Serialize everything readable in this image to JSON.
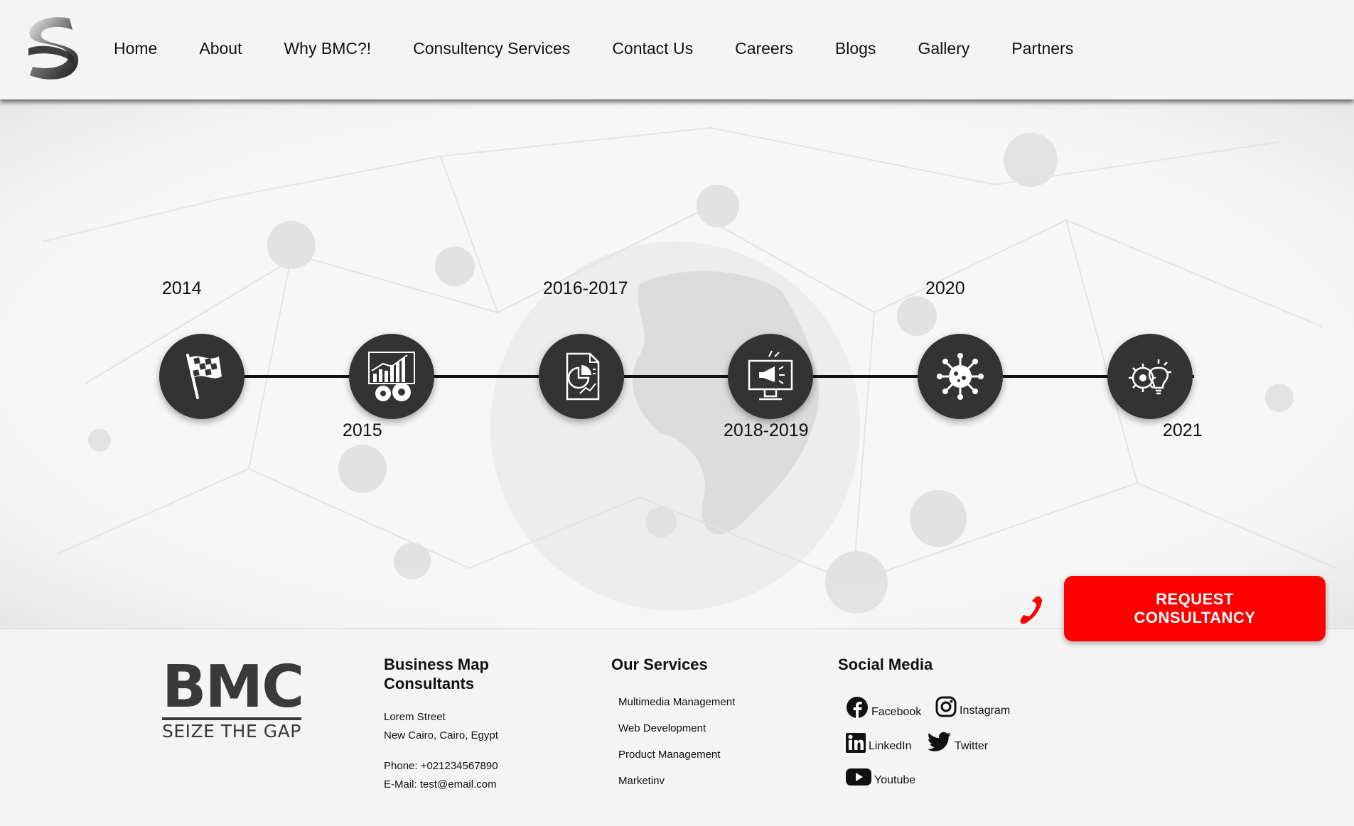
{
  "header": {
    "logo": "bmc-s-logo-icon",
    "nav": [
      "Home",
      "About",
      "Why BMC?!",
      "Consultency Services",
      "Contact Us",
      "Careers",
      "Blogs",
      "Gallery",
      "Partners"
    ]
  },
  "timeline": {
    "years": {
      "y2014": "2014",
      "y2015": "2015",
      "y2016": "2016-2017",
      "y2018": "2018-2019",
      "y2020": "2020",
      "y2021": "2021"
    },
    "icons": [
      "checkered-flag-icon",
      "growth-chart-gears-icon",
      "report-document-icon",
      "monitor-megaphone-icon",
      "virus-icon",
      "gear-lightbulb-icon"
    ]
  },
  "cta": {
    "label": "REQUEST CONSULTANCY",
    "icon": "phone-icon"
  },
  "footer": {
    "brand": {
      "big": "BMC",
      "tagline": "SEIZE THE GAP"
    },
    "company": {
      "title_line1": "Business Map",
      "title_line2": "Consultants",
      "address_line1": "Lorem Street",
      "address_line2": "New Cairo, Cairo, Egypt",
      "phone": "Phone: +021234567890",
      "email": "E-Mail: test@email.com"
    },
    "services": {
      "title": "Our Services",
      "items": [
        "Multimedia Management",
        "Web Development",
        "Product Management",
        "Marketinv"
      ]
    },
    "social": {
      "title": "Social Media",
      "facebook": "Facebook",
      "instagram": "Instagram",
      "linkedin": "LinkedIn",
      "twitter": "Twitter",
      "youtube": "Youtube"
    }
  },
  "colors": {
    "accent": "#ff0000",
    "node": "#333333",
    "background": "#f4f4f4"
  }
}
